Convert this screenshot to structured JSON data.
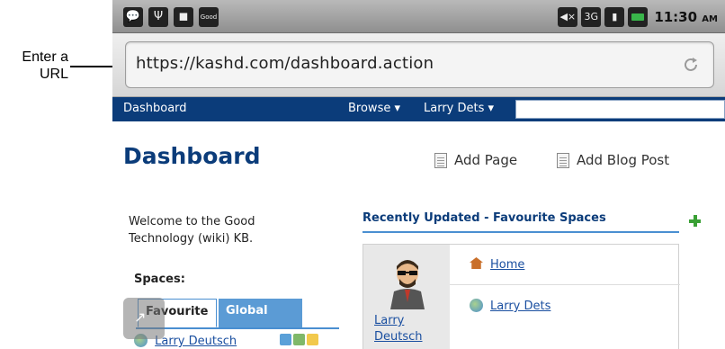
{
  "annotation": {
    "callout": "Enter a URL"
  },
  "status_bar": {
    "left_icons": [
      "chat-icon",
      "usb-icon",
      "android-debug-icon",
      "good-app-icon"
    ],
    "good_label": "Good",
    "right_icons": [
      "mute-icon",
      "3g-icon",
      "signal-icon",
      "battery-charging-icon"
    ],
    "network_label": "3G",
    "time": "11:30",
    "ampm": "AM"
  },
  "browser": {
    "url": "https://kashd.com/dashboard.action",
    "refresh_icon": "refresh-icon"
  },
  "nav": {
    "dashboard": "Dashboard",
    "browse": "Browse ▾",
    "user": "Larry Dets ▾",
    "search_placeholder": ""
  },
  "page": {
    "title": "Dashboard",
    "add_page": "Add Page",
    "add_blog_post": "Add Blog Post",
    "welcome": "Welcome to the Good Technology (wiki) KB.",
    "spaces_label": "Spaces:",
    "tabs": [
      "Favourite",
      "Global"
    ],
    "space_row": "Larry Deutsch",
    "recent": {
      "title": "Recently Updated - Favourite Spaces",
      "user": "Larry Deutsch",
      "items": [
        "Home",
        "Larry Dets"
      ]
    }
  },
  "colors": {
    "nav_bg": "#0b3c7a",
    "title": "#0b3c7a",
    "link": "#1a4fa0",
    "accent_tab": "#5b9bd5",
    "add_plus": "#3aa035"
  }
}
